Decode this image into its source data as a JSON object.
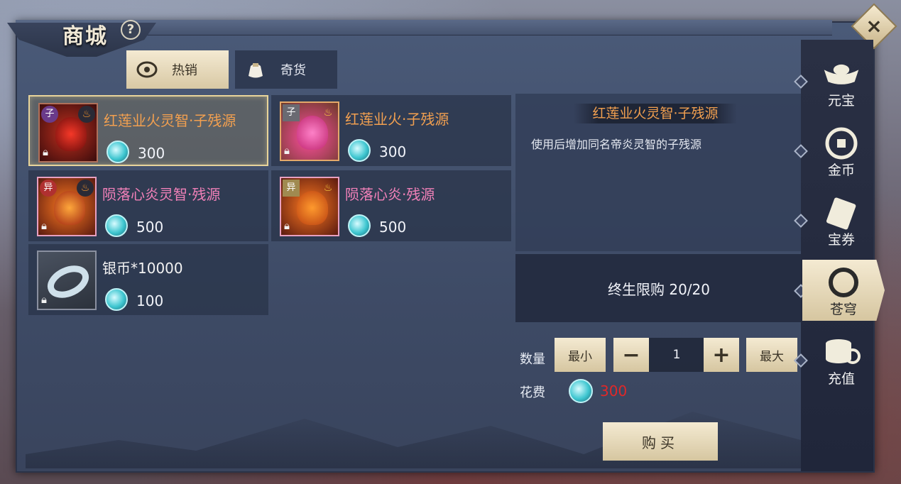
{
  "header": {
    "title": "商城",
    "help": "?",
    "close": "×"
  },
  "tabs": [
    {
      "label": "热销",
      "icon": "dragon-icon",
      "active": true
    },
    {
      "label": "奇货",
      "icon": "pouch-icon",
      "active": false
    }
  ],
  "items": [
    {
      "name": "红莲业火灵智·子残源",
      "price": "300",
      "badge": "子",
      "selected": true
    },
    {
      "name": "红莲业火·子残源",
      "price": "300",
      "badge": "子",
      "selected": false
    },
    {
      "name": "陨落心炎灵智·残源",
      "price": "500",
      "badge": "异",
      "selected": false
    },
    {
      "name": "陨落心炎·残源",
      "price": "500",
      "badge": "异",
      "selected": false
    },
    {
      "name": "银币*10000",
      "price": "100",
      "selected": false
    }
  ],
  "detail": {
    "title": "红莲业火灵智·子残源",
    "description": "使用后增加同名帝炎灵智的子残源",
    "limit": "终生限购 20/20"
  },
  "purchase": {
    "qty_label": "数量",
    "min_label": "最小",
    "minus": "−",
    "quantity": "1",
    "plus": "+",
    "max_label": "最大",
    "cost_label": "花费",
    "cost_value": "300",
    "buy_label": "购买"
  },
  "side_nav": [
    {
      "label": "元宝",
      "icon": "ingot-icon",
      "active": false
    },
    {
      "label": "金币",
      "icon": "gold-coin-icon",
      "active": false
    },
    {
      "label": "宝券",
      "icon": "ticket-icon",
      "active": false
    },
    {
      "label": "苍穹",
      "icon": "sky-emblem-icon",
      "active": true
    },
    {
      "label": "充值",
      "icon": "coin-stack-icon",
      "active": false
    }
  ],
  "colors": {
    "accent_gold": "#e8d49a",
    "name_orange": "#f2a050",
    "name_pink": "#f080b8",
    "cost_red": "#e02828",
    "panel_bg": "#44526f"
  }
}
